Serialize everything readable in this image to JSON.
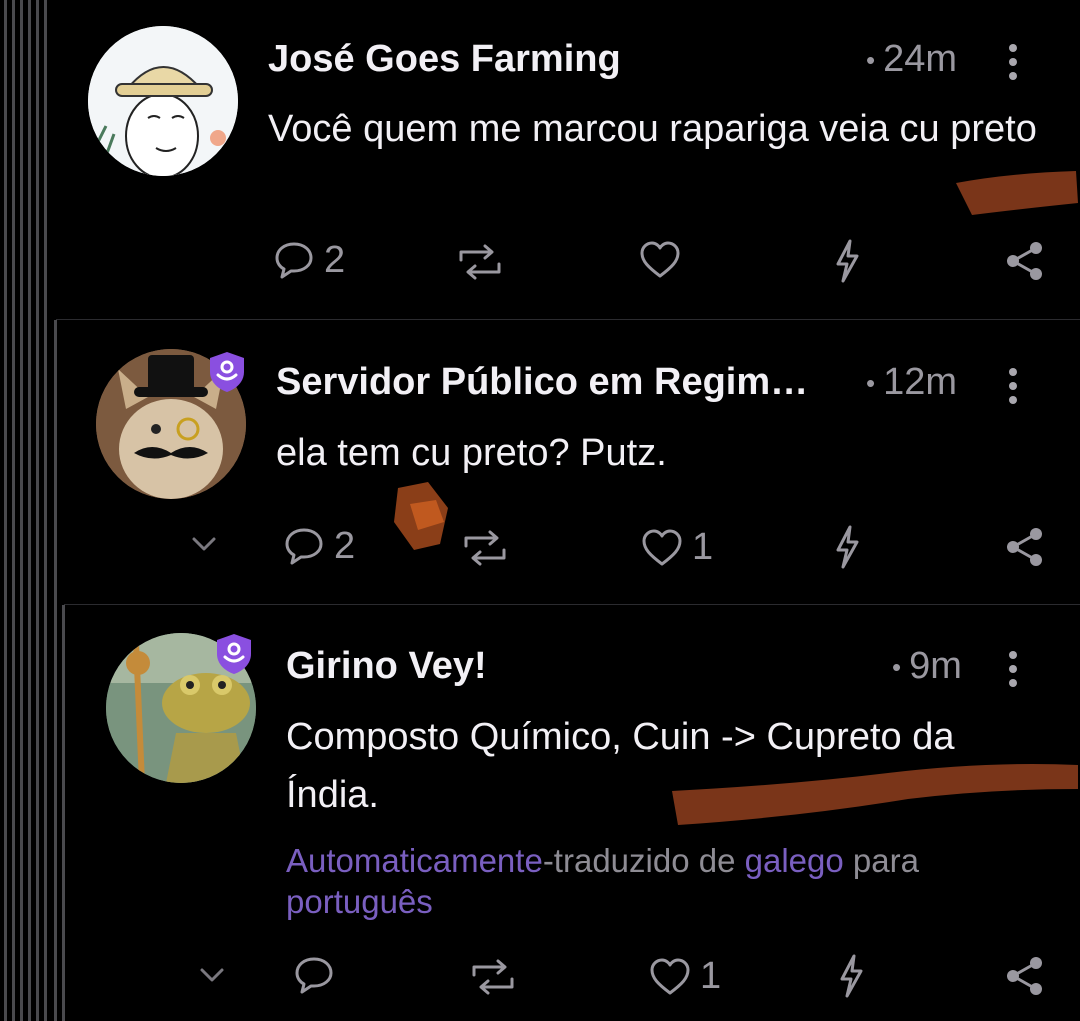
{
  "posts": [
    {
      "author": "José Goes Farming",
      "time": "24m",
      "text": "Você quem me marcou rapariga veia cu preto",
      "replies": "2",
      "likes": "",
      "verified": false
    },
    {
      "author": "Servidor Público em Regim…",
      "time": "12m",
      "text": "ela tem cu preto? Putz.",
      "replies": "2",
      "likes": "1",
      "verified": true
    },
    {
      "author": "Girino Vey!",
      "time": "9m",
      "text": "Composto Químico, Cuin -> Cupreto da Índia.",
      "replies": "",
      "likes": "1",
      "verified": true,
      "translation": {
        "auto": "Automaticamente",
        "mid": "-traduzido de ",
        "source_lang": "galego",
        "to": " para ",
        "target_lang": "português"
      }
    }
  ],
  "icons": {
    "reply": "speech-bubble-icon",
    "repost": "repost-icon",
    "like": "heart-icon",
    "zap": "lightning-icon",
    "share": "share-icon",
    "more": "kebab-menu-icon",
    "collapse": "chevron-down-icon",
    "badge": "shield-badge-icon"
  },
  "colors": {
    "background": "#000000",
    "text": "#f2f0f5",
    "muted": "#9a98a0",
    "accent": "#7a5fc0",
    "badge": "#8a4fe0"
  }
}
